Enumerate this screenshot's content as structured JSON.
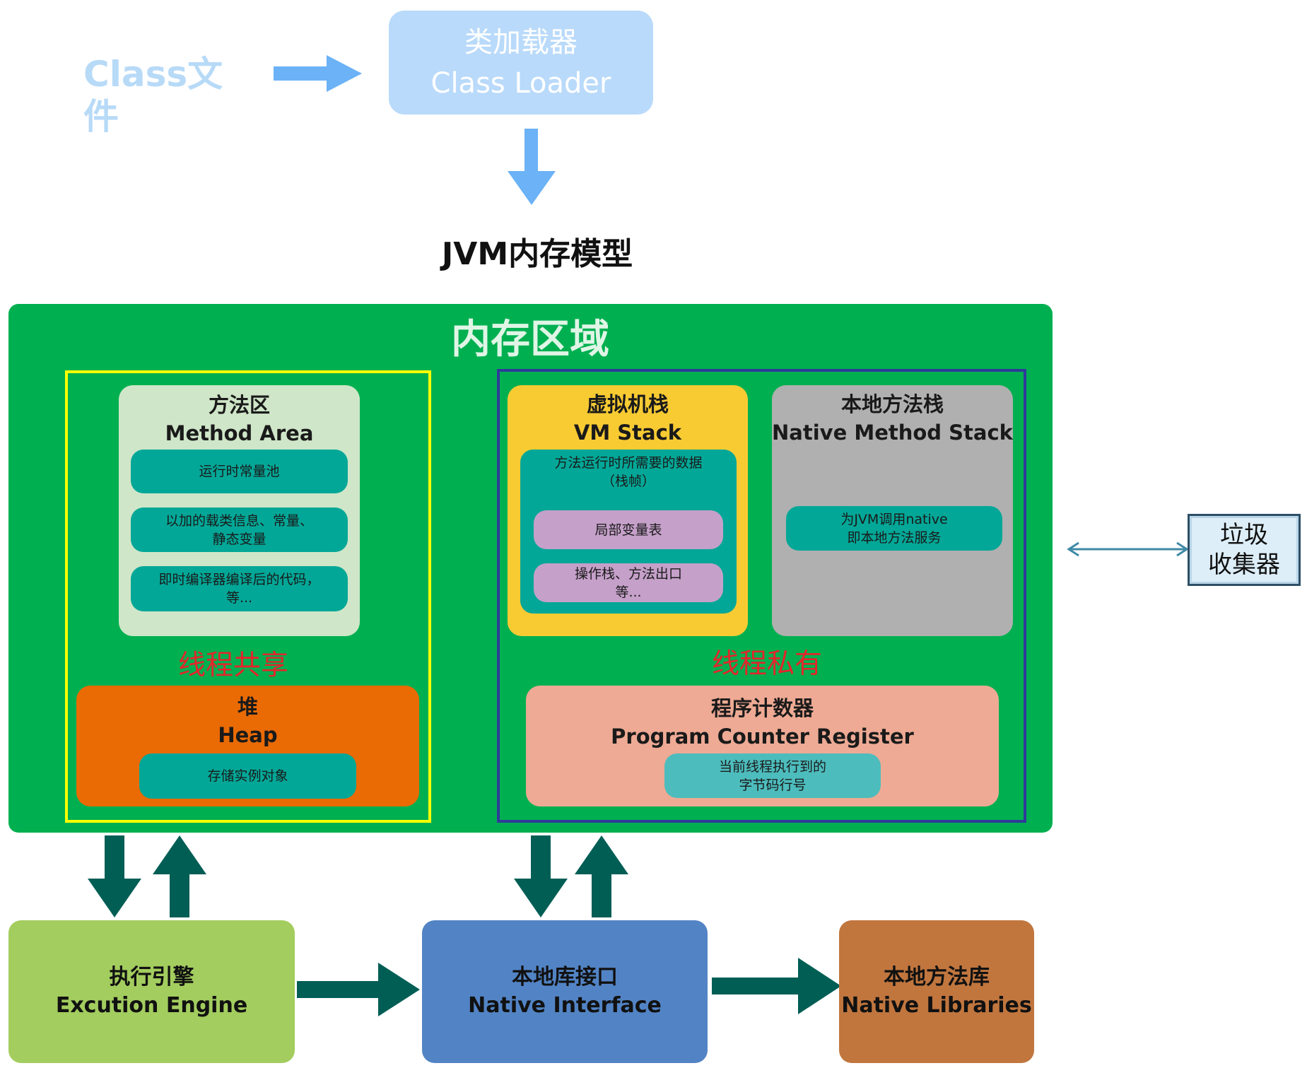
{
  "top": {
    "class_file": "Class文件",
    "class_loader_cn": "类加载器",
    "class_loader_en": "Class Loader"
  },
  "jvm_title": "JVM内存模型",
  "memory_area": {
    "title": "内存区域",
    "shared_label": "线程共享",
    "private_label": "线程私有",
    "method_area": {
      "title_cn": "方法区",
      "title_en": "Method Area",
      "items": [
        {
          "line1": "运行时常量池",
          "line2": ""
        },
        {
          "line1": "以加的载类信息、常量、",
          "line2": "静态变量"
        },
        {
          "line1": "即时编译器编译后的代码，",
          "line2": "等..."
        }
      ]
    },
    "heap": {
      "title_cn": "堆",
      "title_en": "Heap",
      "item": "存储实例对象"
    },
    "vm_stack": {
      "title_cn": "虚拟机栈",
      "title_en": "VM Stack",
      "frame_line1": "方法运行时所需要的数据",
      "frame_line2": "（栈帧）",
      "local_vars": "局部变量表",
      "operand_line1": "操作栈、方法出口",
      "operand_line2": "等..."
    },
    "native_stack": {
      "title_cn": "本地方法栈",
      "title_en": "Native Method Stack",
      "item_line1": "为JVM调用native",
      "item_line2": "即本地方法服务"
    },
    "pc_register": {
      "title_cn": "程序计数器",
      "title_en": "Program Counter Register",
      "item_line1": "当前线程执行到的",
      "item_line2": "字节码行号"
    }
  },
  "gc": {
    "line1": "垃圾",
    "line2": "收集器"
  },
  "bottom": {
    "exec": {
      "cn": "执行引擎",
      "en": "Excution Engine"
    },
    "native_interface": {
      "cn": "本地库接口",
      "en": "Native Interface"
    },
    "native_libraries": {
      "cn": "本地方法库",
      "en": "Native Libraries"
    }
  },
  "colors": {
    "memory_bg": "#00b050",
    "loader_bg": "#b9dafa",
    "arrow_blue": "#6bb2f6",
    "arrow_dark": "#005e55",
    "shared_border": "#ffff00",
    "private_border": "#2f3a9a",
    "label_red": "#e3262b"
  }
}
